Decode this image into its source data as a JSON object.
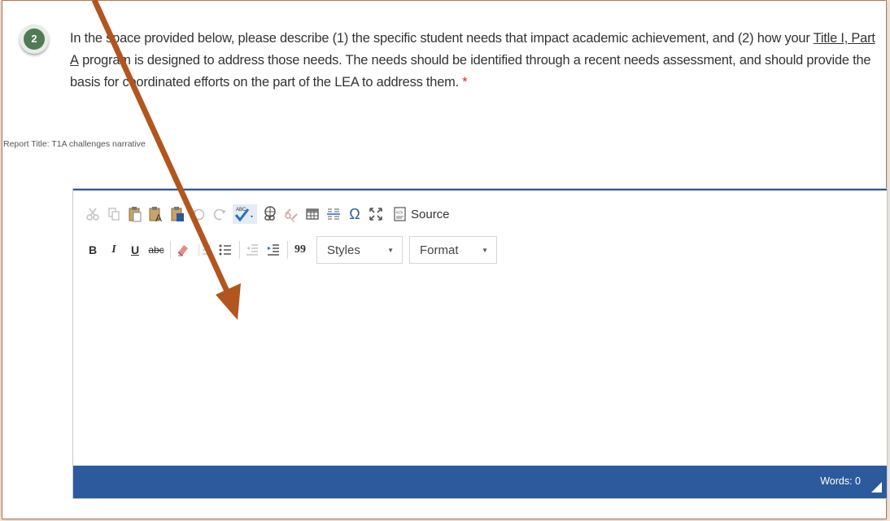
{
  "question": {
    "number": "2",
    "text_part1": "In the space provided below, please describe (1) the specific student needs that impact academic achievement, and (2) how your ",
    "link_text": "Title I, Part A",
    "text_part2": " program is designed to address those needs.  The needs should be identified through a recent needs assessment, and should provide the basis for coordinated efforts on the part of the LEA to address them.",
    "required_marker": " *"
  },
  "report_title": "Report Title: T1A challenges narrative",
  "toolbar": {
    "row1": [
      "cut-icon",
      "copy-icon",
      "paste-icon",
      "paste-text-icon",
      "paste-word-icon",
      "undo-icon",
      "redo-icon",
      "spellcheck-icon",
      "link-icon",
      "unlink-icon",
      "table-icon",
      "horizontal-rule-icon",
      "special-char-icon",
      "maximize-icon",
      "source-icon"
    ],
    "source_label": "Source",
    "row2": [
      "bold",
      "italic",
      "underline",
      "strikethrough",
      "remove-format",
      "numbered-list",
      "bulleted-list",
      "decrease-indent",
      "increase-indent",
      "blockquote"
    ],
    "bold_label": "B",
    "italic_label": "I",
    "underline_label": "U",
    "strike_label": "abc",
    "omega_label": "Ω",
    "quote_label": "99",
    "styles_label": "Styles",
    "format_label": "Format"
  },
  "editor": {
    "content": "",
    "status_words": "Words: 0"
  },
  "colors": {
    "accent_blue": "#2c5a9c",
    "badge_green": "#4f7a55",
    "annotation_arrow": "#b2561f",
    "frame_border": "#b8764a"
  }
}
